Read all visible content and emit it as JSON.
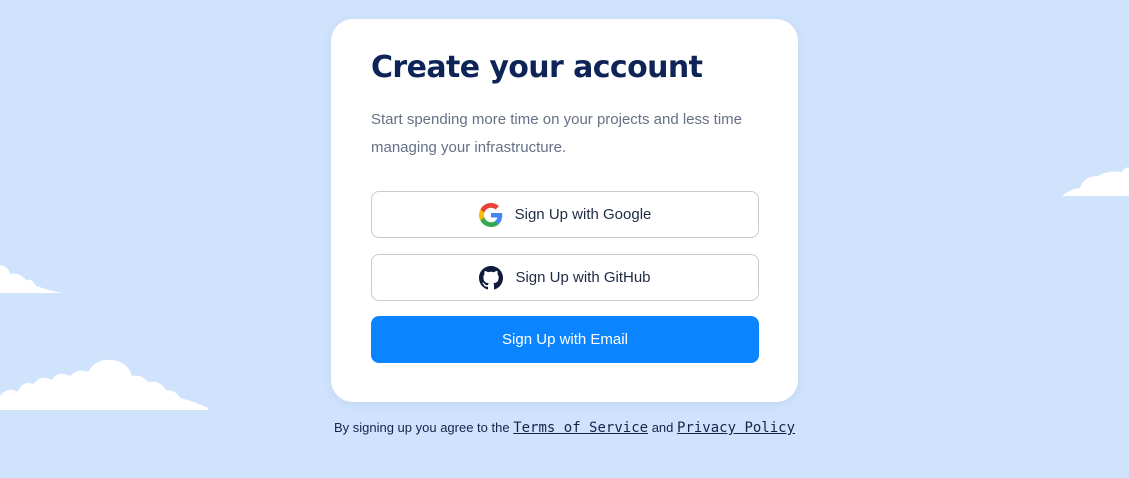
{
  "card": {
    "title": "Create your account",
    "subtitle": "Start spending more time on your projects and less time managing your infrastructure."
  },
  "buttons": {
    "google": {
      "label": "Sign Up with Google",
      "icon": "google-icon"
    },
    "github": {
      "label": "Sign Up with GitHub",
      "icon": "github-icon"
    },
    "email": {
      "label": "Sign Up with Email"
    }
  },
  "legal": {
    "prefix": "By signing up you agree to the",
    "terms": "Terms of Service",
    "and": "and",
    "privacy": "Privacy Policy"
  },
  "colors": {
    "background": "#d0e3fd",
    "primary": "#0a84ff",
    "title": "#0e2356"
  }
}
